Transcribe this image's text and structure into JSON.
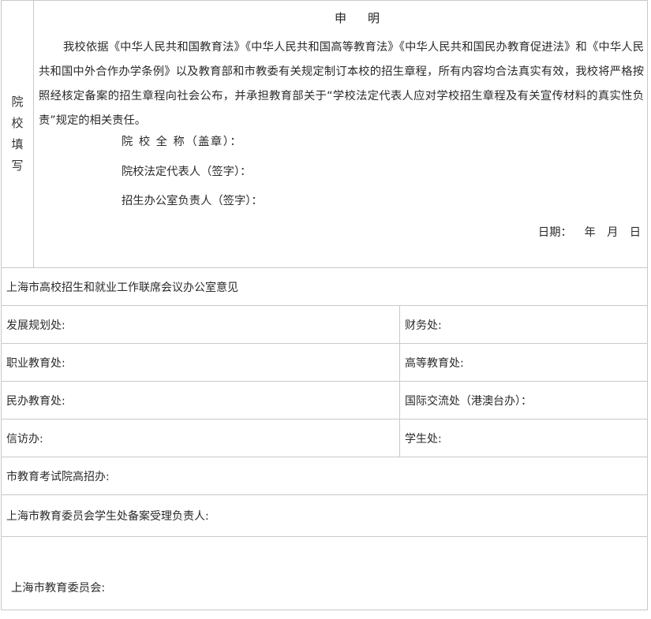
{
  "declaration": {
    "side_label_chars": [
      "院",
      "校",
      "填",
      "写"
    ],
    "title": "申　明",
    "body": "我校依据《中华人民共和国教育法》《中华人民共和国高等教育法》《中华人民共和国民办教育促进法》和《中华人民共和国中外合作办学条例》以及教育部和市教委有关规定制订本校的招生章程，所有内容均合法真实有效，我校将严格按照经核定备案的招生章程向社会公布，并承担教育部关于“学校法定代表人应对学校招生章程及有关宣传材料的真实性负责”规定的相关责任。",
    "signatures": {
      "school_name": "院 校 全 称（盖章）：",
      "legal_rep": "院校法定代表人（签字）：",
      "admissions_head": "招生办公室负责人（签字）："
    },
    "date_line": "日期：　 年　月　日"
  },
  "approvals": {
    "committee_heading": "上海市高校招生和就业工作联席会议办公室意见",
    "rows": [
      {
        "left": "发展规划处:",
        "right": "财务处:"
      },
      {
        "left": "职业教育处:",
        "right": "高等教育处:"
      },
      {
        "left": "民办教育处:",
        "right": "国际交流处（港澳台办）："
      },
      {
        "left": "信访办:",
        "right": "学生处:"
      }
    ],
    "exam_office": "市教育考试院高招办:",
    "student_office_filing": "上海市教育委员会学生处备案受理负责人:",
    "commission": "上海市教育委员会:"
  }
}
